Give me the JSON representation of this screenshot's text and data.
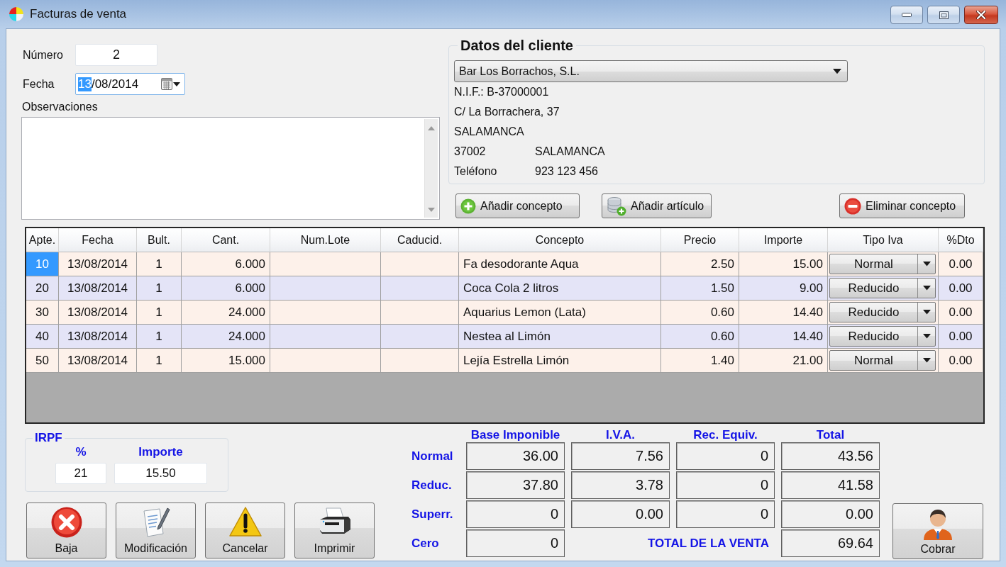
{
  "window": {
    "title": "Facturas de venta"
  },
  "invoice": {
    "number": {
      "label": "Número",
      "value": "2"
    },
    "date": {
      "label": "Fecha",
      "value_parts": [
        {
          "text": "13",
          "selected": true
        },
        {
          "text": "/08/2014",
          "selected": false
        }
      ]
    },
    "notes": {
      "label": "Observaciones"
    }
  },
  "client": {
    "title": "Datos del cliente",
    "selected_client": "Bar Los Borrachos, S.L.",
    "details": [
      [
        "N.I.F.: B-37000001"
      ],
      [
        "C/ La Borrachera, 37"
      ],
      [
        "SALAMANCA"
      ],
      [
        "37002",
        "SALAMANCA"
      ],
      [
        "Teléfono",
        "923 123 456"
      ]
    ]
  },
  "line_actions": [
    {
      "label": "Añadir concepto",
      "kind": "add"
    },
    {
      "label": "Añadir artículo",
      "kind": "add-item"
    },
    {
      "label": "Eliminar concepto",
      "kind": "remove"
    }
  ],
  "grid": {
    "columns": [
      "Apte.",
      "Fecha",
      "Bult.",
      "Cant.",
      "Num.Lote",
      "Caducid.",
      "Concepto",
      "Precio",
      "Importe",
      "Tipo Iva",
      "%Dto"
    ],
    "rows": [
      {
        "apte": "10",
        "fecha": "13/08/2014",
        "bult": "1",
        "cant": "6.000",
        "concepto": "Fa desodorante Aqua",
        "precio": "2.50",
        "importe": "15.00",
        "tipo_iva": "Normal",
        "dto": "0.00",
        "selected": true
      },
      {
        "apte": "20",
        "fecha": "13/08/2014",
        "bult": "1",
        "cant": "6.000",
        "concepto": "Coca Cola 2 litros",
        "precio": "1.50",
        "importe": "9.00",
        "tipo_iva": "Reducido",
        "dto": "0.00",
        "selected": false
      },
      {
        "apte": "30",
        "fecha": "13/08/2014",
        "bult": "1",
        "cant": "24.000",
        "concepto": "Aquarius Lemon (Lata)",
        "precio": "0.60",
        "importe": "14.40",
        "tipo_iva": "Reducido",
        "dto": "0.00",
        "selected": false
      },
      {
        "apte": "40",
        "fecha": "13/08/2014",
        "bult": "1",
        "cant": "24.000",
        "concepto": "Nestea al Limón",
        "precio": "0.60",
        "importe": "14.40",
        "tipo_iva": "Reducido",
        "dto": "0.00",
        "selected": false
      },
      {
        "apte": "50",
        "fecha": "13/08/2014",
        "bult": "1",
        "cant": "15.000",
        "concepto": "Lejía Estrella Limón",
        "precio": "1.40",
        "importe": "21.00",
        "tipo_iva": "Normal",
        "dto": "0.00",
        "selected": false
      }
    ]
  },
  "irpf": {
    "title": "IRPF",
    "fields": [
      {
        "label": "%",
        "value": "21"
      },
      {
        "label": "Importe",
        "value": "15.50"
      }
    ]
  },
  "actions": [
    {
      "label": "Baja",
      "kind": "delete"
    },
    {
      "label": "Modificación",
      "kind": "edit"
    },
    {
      "label": "Cancelar",
      "kind": "cancel"
    },
    {
      "label": "Imprimir",
      "kind": "print"
    }
  ],
  "totals": {
    "columns": [
      "Base Imponible",
      "I.V.A.",
      "Rec. Equiv.",
      "Total"
    ],
    "rows": [
      {
        "label": "Normal",
        "values": [
          "36.00",
          "7.56",
          "0",
          "43.56"
        ]
      },
      {
        "label": "Reduc.",
        "values": [
          "37.80",
          "3.78",
          "0",
          "41.58"
        ]
      },
      {
        "label": "Superr.",
        "values": [
          "0",
          "0.00",
          "0",
          "0.00"
        ]
      },
      {
        "label": "Cero",
        "values": [
          "0"
        ]
      }
    ],
    "grand_total": {
      "label": "TOTAL DE LA VENTA",
      "value": "69.64"
    }
  },
  "collect_button": {
    "label": "Cobrar"
  }
}
